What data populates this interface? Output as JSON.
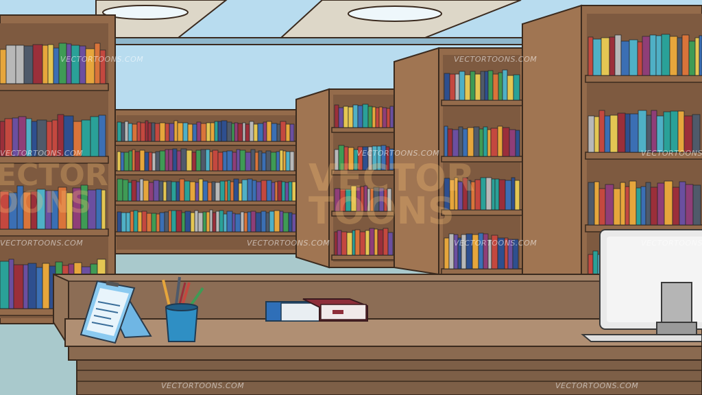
{
  "scene": {
    "watermark_text": "VECTORTOONS.COM",
    "logo_line1": "VECTOR",
    "logo_line2": "TOONS"
  },
  "palette": {
    "sky": "#a9d3e8",
    "wall": "#b8dcef",
    "ceiling": "#ddd7c8",
    "wood": "#946b4b",
    "wood_dark": "#6d4b33",
    "wood_inner": "#7e5a40",
    "desk": "#a5856a",
    "floor": "#a9c9cc",
    "monitor": "#e9e9e9"
  },
  "book_colors": [
    "#3b6fb4",
    "#2aa198",
    "#c4483f",
    "#e6a63c",
    "#6b4fa0",
    "#3f9b55",
    "#d9743a",
    "#4f5a6a",
    "#b8b8b8",
    "#8f3e78",
    "#4fb0c6",
    "#e4c653",
    "#2e4f8f",
    "#9b2f3a"
  ]
}
